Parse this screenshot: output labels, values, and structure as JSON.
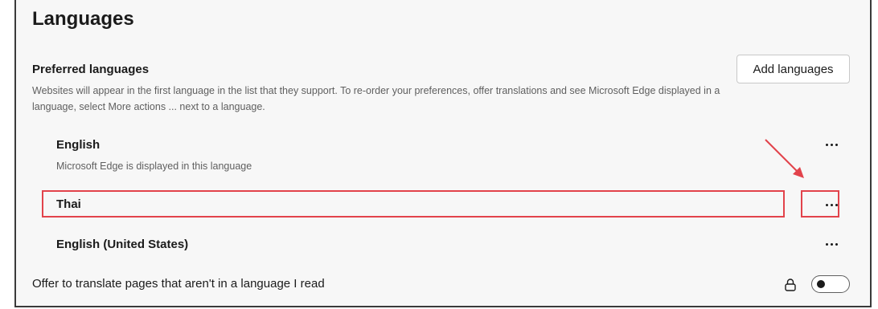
{
  "languages": {
    "title": "Languages",
    "preferred": {
      "title": "Preferred languages",
      "description": "Websites will appear in the first language in the list that they support. To re-order your preferences, offer translations and see Microsoft Edge displayed in a language, select More actions ... next to a language.",
      "add_button_label": "Add languages"
    },
    "items": [
      {
        "name": "English",
        "subtitle": "Microsoft Edge is displayed in this language"
      },
      {
        "name": "Thai"
      },
      {
        "name": "English (United States)"
      }
    ],
    "translate_toggle": {
      "label": "Offer to translate pages that aren't in a language I read",
      "state": "off",
      "icon": "lock-icon"
    }
  },
  "annotation": {
    "highlight_color": "#e2434b",
    "arrow_target": "more-actions-thai"
  }
}
